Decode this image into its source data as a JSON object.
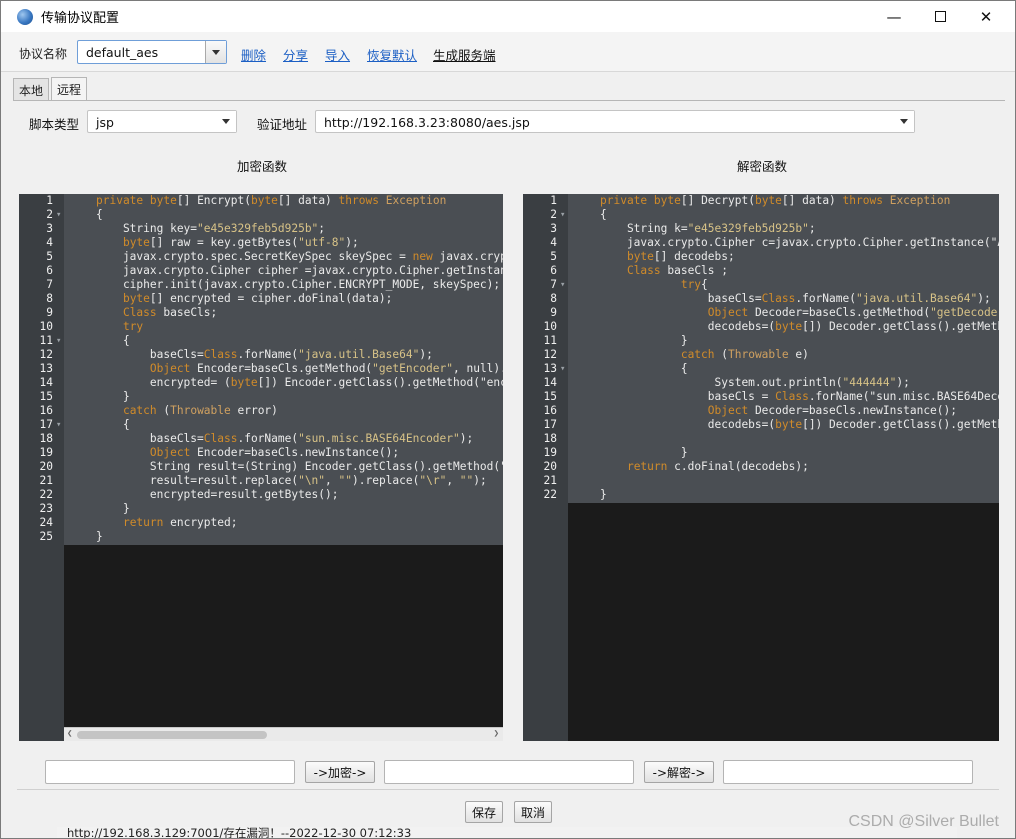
{
  "window": {
    "title": "传输协议配置"
  },
  "toolbar": {
    "protocol_label": "协议名称",
    "protocol_value": "default_aes",
    "links": [
      "删除",
      "分享",
      "导入",
      "恢复默认",
      "生成服务端"
    ]
  },
  "tabs": [
    "本地",
    "远程"
  ],
  "script": {
    "type_label": "脚本类型",
    "type_value": "jsp",
    "url_label": "验证地址",
    "url_value": "http://192.168.3.23:8080/aes.jsp"
  },
  "encrypt": {
    "title": "加密函数",
    "lines": [
      "private byte[] Encrypt(byte[] data) throws Exception",
      "{",
      "    String key=\"e45e329feb5d925b\";",
      "    byte[] raw = key.getBytes(\"utf-8\");",
      "    javax.crypto.spec.SecretKeySpec skeySpec = new javax.crypt",
      "    javax.crypto.Cipher cipher =javax.crypto.Cipher.getInstanc",
      "    cipher.init(javax.crypto.Cipher.ENCRYPT_MODE, skeySpec);",
      "    byte[] encrypted = cipher.doFinal(data);",
      "    Class baseCls;",
      "    try",
      "    {",
      "        baseCls=Class.forName(\"java.util.Base64\");",
      "        Object Encoder=baseCls.getMethod(\"getEncoder\", null).i",
      "        encrypted= (byte[]) Encoder.getClass().getMethod(\"enco",
      "    }",
      "    catch (Throwable error)",
      "    {",
      "        baseCls=Class.forName(\"sun.misc.BASE64Encoder\");",
      "        Object Encoder=baseCls.newInstance();",
      "        String result=(String) Encoder.getClass().getMethod(\"e",
      "        result=result.replace(\"\\n\", \"\").replace(\"\\r\", \"\");",
      "        encrypted=result.getBytes();",
      "    }",
      "    return encrypted;",
      "}"
    ]
  },
  "decrypt": {
    "title": "解密函数",
    "lines": [
      "private byte[] Decrypt(byte[] data) throws Exception",
      "{",
      "    String k=\"e45e329feb5d925b\";",
      "    javax.crypto.Cipher c=javax.crypto.Cipher.getInstance(\"AE",
      "    byte[] decodebs;",
      "    Class baseCls ;",
      "            try{",
      "                baseCls=Class.forName(\"java.util.Base64\");",
      "                Object Decoder=baseCls.getMethod(\"getDecoder\"",
      "                decodebs=(byte[]) Decoder.getClass().getMetho",
      "            }",
      "            catch (Throwable e)",
      "            {",
      "                 System.out.println(\"444444\");",
      "                baseCls = Class.forName(\"sun.misc.BASE64Decod",
      "                Object Decoder=baseCls.newInstance();",
      "                decodebs=(byte[]) Decoder.getClass().getMetho",
      "",
      "            }",
      "    return c.doFinal(decodebs);",
      "",
      "}"
    ]
  },
  "actions": {
    "encrypt_button": "->加密->",
    "decrypt_button": "->解密->",
    "save_button": "保存",
    "cancel_button": "取消"
  },
  "status": {
    "text": "http://192.168.3.129:7001/存在漏洞！--2022-12-30 07:12:33"
  },
  "watermark": "CSDN @Silver     Bullet"
}
